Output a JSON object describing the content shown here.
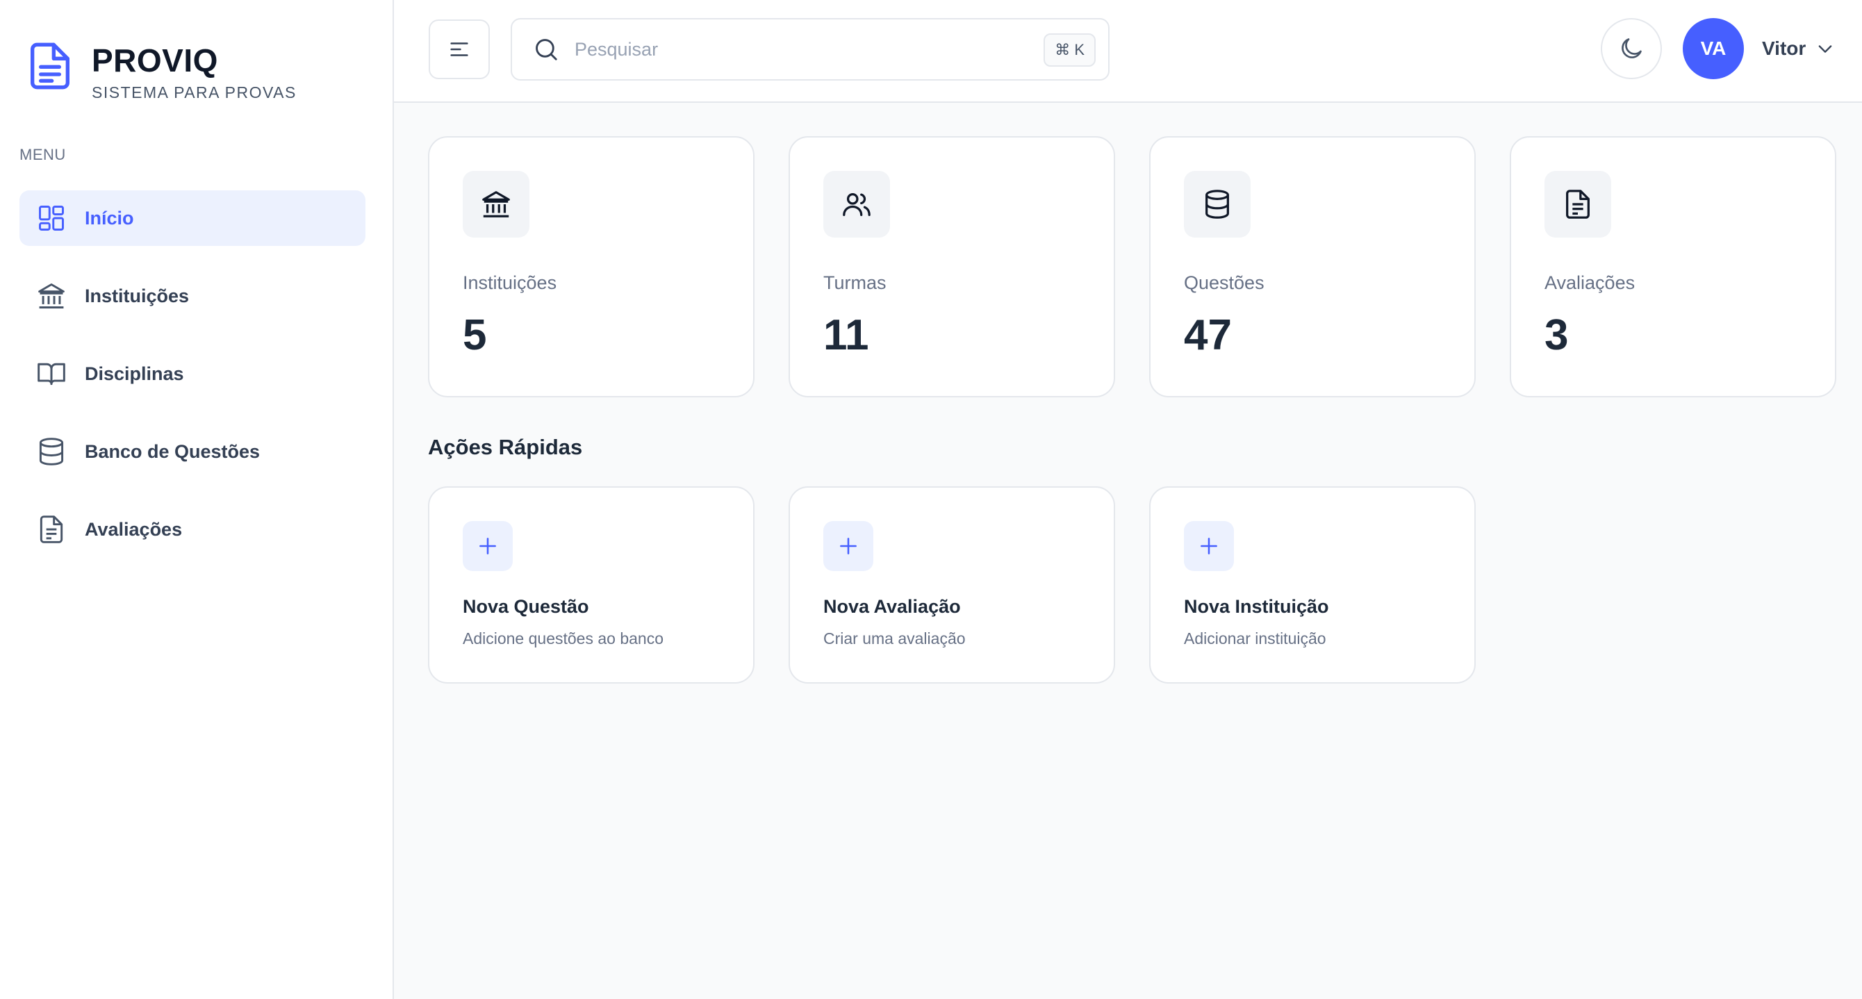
{
  "brand": {
    "name": "PROVIQ",
    "subtitle": "SISTEMA PARA PROVAS"
  },
  "sidebar": {
    "menu_label": "MENU",
    "items": [
      {
        "label": "Início",
        "icon": "grid-icon",
        "active": true
      },
      {
        "label": "Instituições",
        "icon": "bank-icon",
        "active": false
      },
      {
        "label": "Disciplinas",
        "icon": "book-icon",
        "active": false
      },
      {
        "label": "Banco de Questões",
        "icon": "database-icon",
        "active": false
      },
      {
        "label": "Avaliações",
        "icon": "document-icon",
        "active": false
      }
    ]
  },
  "header": {
    "search_placeholder": "Pesquisar",
    "search_shortcut": "⌘ K",
    "user_initials": "VA",
    "user_name": "Vitor"
  },
  "stats": [
    {
      "label": "Instituições",
      "value": "5",
      "icon": "bank-icon"
    },
    {
      "label": "Turmas",
      "value": "11",
      "icon": "users-icon"
    },
    {
      "label": "Questões",
      "value": "47",
      "icon": "database-icon"
    },
    {
      "label": "Avaliações",
      "value": "3",
      "icon": "document-icon"
    }
  ],
  "quick_actions": {
    "title": "Ações Rápidas",
    "items": [
      {
        "title": "Nova Questão",
        "description": "Adicione questões ao banco",
        "icon": "plus-icon"
      },
      {
        "title": "Nova Avaliação",
        "description": "Criar uma avaliação",
        "icon": "plus-icon"
      },
      {
        "title": "Nova Instituição",
        "description": "Adicionar instituição",
        "icon": "plus-icon"
      }
    ]
  },
  "colors": {
    "accent": "#465fff",
    "active_bg": "#ecf1fe",
    "text": "#1d2939",
    "muted": "#667085",
    "border": "#e4e7ec"
  }
}
